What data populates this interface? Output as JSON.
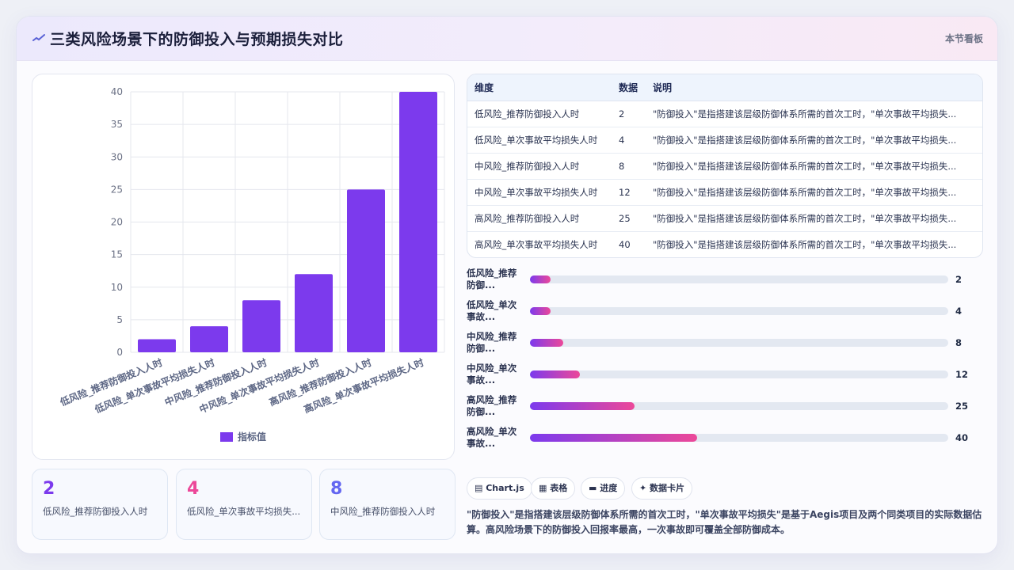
{
  "header": {
    "title": "三类风险场景下的防御投入与预期损失对比",
    "right_label": "本节看板",
    "icon": "sparkline-icon"
  },
  "chart_data": {
    "type": "bar",
    "categories": [
      "低风险_推荐防御投入人时",
      "低风险_单次事故平均损失人时",
      "中风险_推荐防御投入人时",
      "中风险_单次事故平均损失人时",
      "高风险_推荐防御投入人时",
      "高风险_单次事故平均损失人时"
    ],
    "series": [
      {
        "name": "指标值",
        "values": [
          2,
          4,
          8,
          12,
          25,
          40
        ]
      }
    ],
    "ylim": [
      0,
      40
    ],
    "yticks": [
      "0",
      "5",
      "10",
      "15",
      "20",
      "25",
      "30",
      "35",
      "40"
    ],
    "grid": true,
    "legend": "bottom",
    "color": "#7c3aed"
  },
  "kpis": [
    {
      "value": "2",
      "label": "低风险_推荐防御投入人时",
      "color": "#7c3aed"
    },
    {
      "value": "4",
      "label": "低风险_单次事故平均损失...",
      "color": "#ec4899"
    },
    {
      "value": "8",
      "label": "中风险_推荐防御投入人时",
      "color": "#6366f1"
    }
  ],
  "table": {
    "headers": [
      "维度",
      "数据",
      "说明"
    ],
    "rows": [
      [
        "低风险_推荐防御投入人时",
        "2",
        "\"防御投入\"是指搭建该层级防御体系所需的首次工时，\"单次事故平均损失..."
      ],
      [
        "低风险_单次事故平均损失人时",
        "4",
        "\"防御投入\"是指搭建该层级防御体系所需的首次工时，\"单次事故平均损失..."
      ],
      [
        "中风险_推荐防御投入人时",
        "8",
        "\"防御投入\"是指搭建该层级防御体系所需的首次工时，\"单次事故平均损失..."
      ],
      [
        "中风险_单次事故平均损失人时",
        "12",
        "\"防御投入\"是指搭建该层级防御体系所需的首次工时，\"单次事故平均损失..."
      ],
      [
        "高风险_推荐防御投入人时",
        "25",
        "\"防御投入\"是指搭建该层级防御体系所需的首次工时，\"单次事故平均损失..."
      ],
      [
        "高风险_单次事故平均损失人时",
        "40",
        "\"防御投入\"是指搭建该层级防御体系所需的首次工时，\"单次事故平均损失..."
      ]
    ]
  },
  "progress": {
    "max": 100,
    "items": [
      {
        "label": "低风险_推荐防御...",
        "value": 2,
        "text": "2"
      },
      {
        "label": "低风险_单次事故...",
        "value": 4,
        "text": "4"
      },
      {
        "label": "中风险_推荐防御...",
        "value": 8,
        "text": "8"
      },
      {
        "label": "中风险_单次事故...",
        "value": 12,
        "text": "12"
      },
      {
        "label": "高风险_推荐防御...",
        "value": 25,
        "text": "25"
      },
      {
        "label": "高风险_单次事故...",
        "value": 40,
        "text": "40"
      }
    ]
  },
  "tags": [
    {
      "icon": "chart-icon",
      "glyph": "▤",
      "label": "Chart.js"
    },
    {
      "icon": "table-icon",
      "glyph": "▦",
      "label": "表格"
    },
    {
      "icon": "progress-icon",
      "glyph": "▬",
      "label": "进度"
    },
    {
      "icon": "card-icon",
      "glyph": "✦",
      "label": "数据卡片"
    }
  ],
  "footnote": "\"防御投入\"是指搭建该层级防御体系所需的首次工时，\"单次事故平均损失\"是基于Aegis项目及两个同类项目的实际数据估算。高风险场景下的防御投入回报率最高，一次事故即可覆盖全部防御成本。"
}
